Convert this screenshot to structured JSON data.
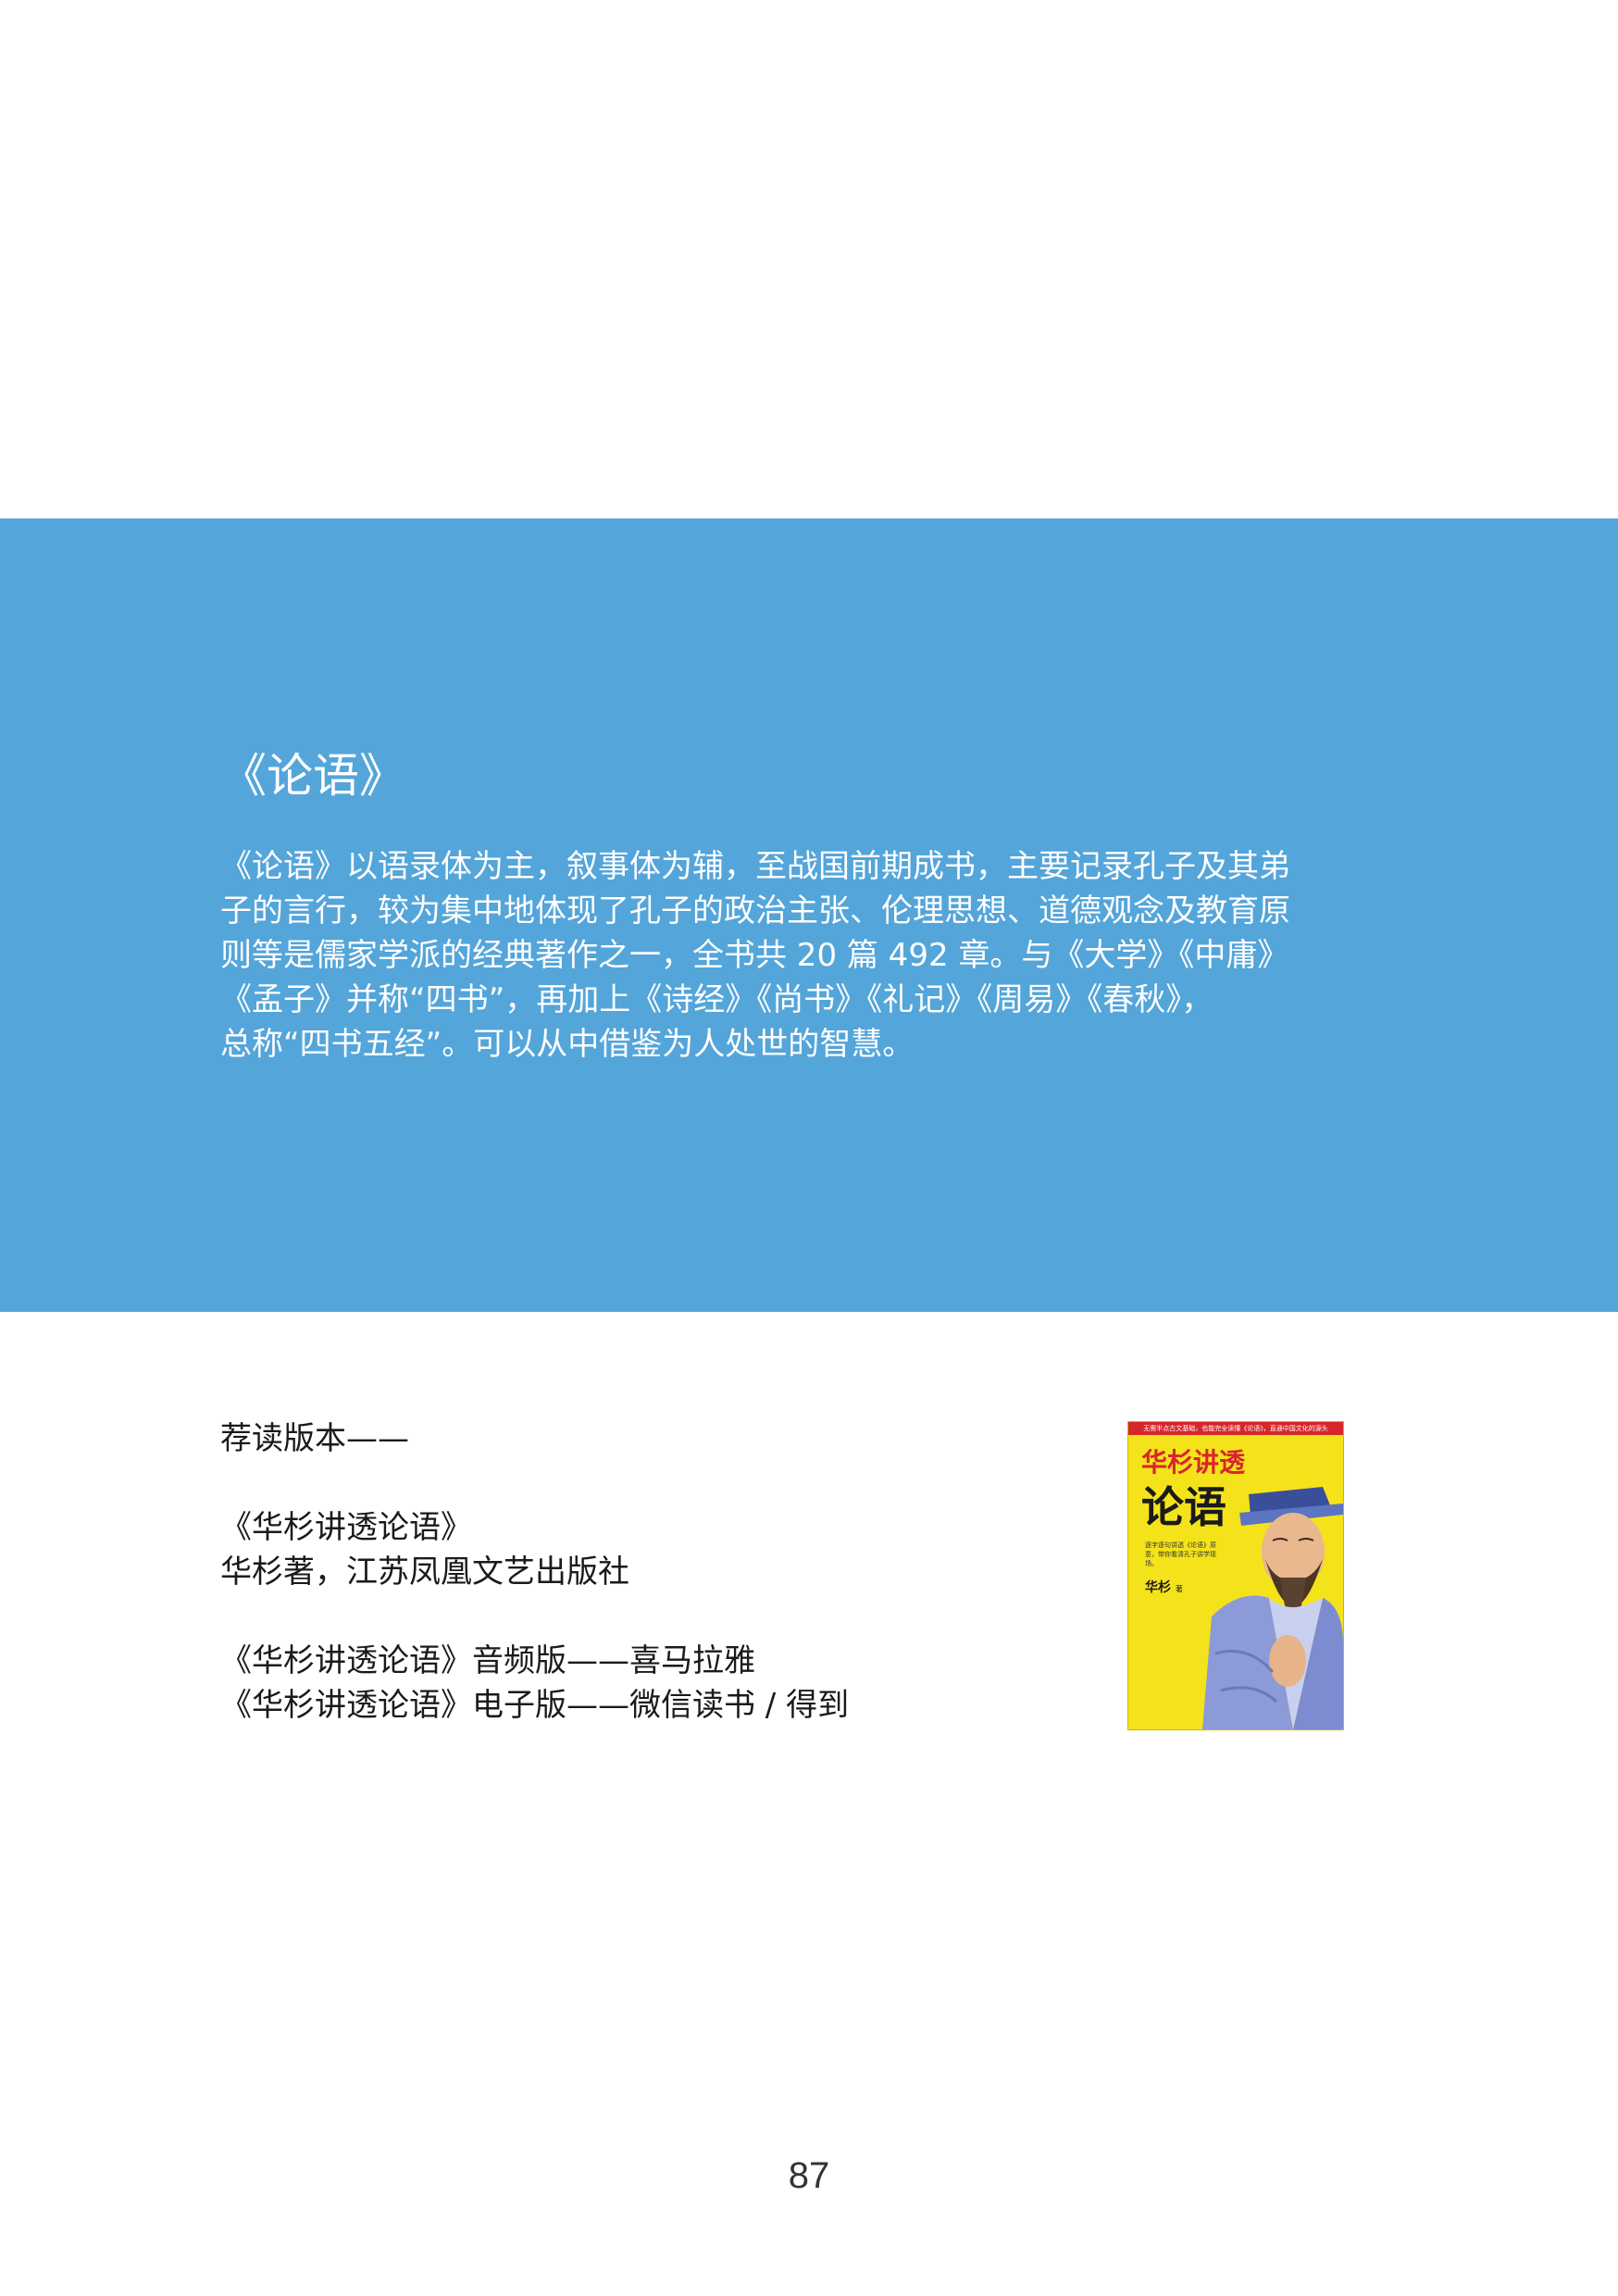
{
  "section": {
    "title": "《论语》",
    "body_lines": [
      "《论语》以语录体为主，叙事体为辅，至战国前期成书，主要记录孔子及其弟",
      "子的言行，较为集中地体现了孔子的政治主张、伦理思想、道德观念及教育原",
      "则等是儒家学派的经典著作之一，全书共 20 篇 492 章。与《大学》《中庸》",
      "《孟子》并称“四书”，再加上《诗经》《尚书》《礼记》《周易》《春秋》，",
      "总称“四书五经”。可以从中借鉴为人处世的智慧。"
    ],
    "band_color": "#54a5da"
  },
  "recommended": {
    "heading": "荐读版本——",
    "book_title": "《华杉讲透论语》",
    "book_author_publisher": "华杉著，江苏凤凰文艺出版社",
    "audio_version": "《华杉讲透论语》音频版——喜马拉雅",
    "ebook_version": "《华杉讲透论语》电子版——微信读书 / 得到"
  },
  "cover": {
    "top_strip": "无需半点古文基础，也能完全读懂《论语》，直通中国文化的源头",
    "title_line1": "华杉讲透",
    "title_line2": "论语",
    "blurb": "逐字逐句讲透《论语》原意，带你看清孔子讲学现场。",
    "author": "华杉",
    "author_suffix": "著",
    "cover_color": "#f4e31a",
    "accent_color": "#d7262b"
  },
  "page_number": "87"
}
